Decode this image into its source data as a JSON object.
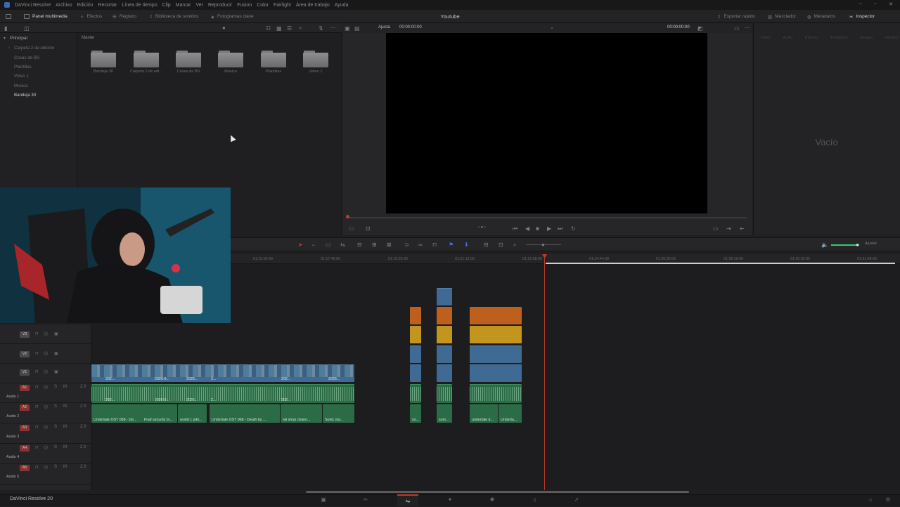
{
  "menu": {
    "items": [
      "DaVinci Resolve",
      "Archivo",
      "Edición",
      "Recortar",
      "Línea de tiempo",
      "Clip",
      "Marcar",
      "Ver",
      "Reproducir",
      "Fusion",
      "Color",
      "Fairlight",
      "Área de trabajo",
      "Ayuda"
    ]
  },
  "toolbar": {
    "media_pool": "Panel multimedia",
    "effects": "Efectos",
    "log": "Registro",
    "sound_library": "Biblioteca de sonidos",
    "keyframes": "Fotogramas clave",
    "project_title": "Youtube",
    "quick_export": "Exportar rápido",
    "mixer": "Mezclador",
    "metadata": "Metadatos",
    "inspector": "Inspector"
  },
  "viewer": {
    "zoom": "Ajusta",
    "timecode_left": "00:00:00:00",
    "timecode_right": "00:00:00:00"
  },
  "media_pool": {
    "root": "Principal",
    "bins": [
      "Carpeta 2 de edición",
      "Cosas de BS",
      "Plantillas",
      "Video 1",
      "Musica",
      "Bandeja 30"
    ],
    "breadcrumb": "Master",
    "folders": [
      "Bandeja 30",
      "Carpeta 2 de edi...",
      "Cosas de BS",
      "Musica",
      "Plantillas",
      "Video 1"
    ]
  },
  "inspector": {
    "empty": "Vacío",
    "tabs": [
      "Video",
      "Audio",
      "Efectos",
      "Transición",
      "Imagen",
      "Archivo"
    ]
  },
  "timeline": {
    "ruler": [
      "01:15:54:00",
      "01:17:40:00",
      "01:19:26:00",
      "01:21:12:00",
      "01:22:58:00",
      "01:24:44:00",
      "01:26:30:00",
      "01:28:16:00",
      "01:30:02:00",
      "01:31:48:00"
    ],
    "tracks": [
      {
        "id": "V3",
        "name": ""
      },
      {
        "id": "V2",
        "name": ""
      },
      {
        "id": "V1",
        "name": ""
      },
      {
        "id": "A1",
        "name": "Audio 1",
        "level": "2.0"
      },
      {
        "id": "A2",
        "name": "Audio 2",
        "level": "2.0"
      },
      {
        "id": "A3",
        "name": "Audio 3",
        "level": "2.0"
      },
      {
        "id": "A4",
        "name": "Audio 4",
        "level": "2.0"
      },
      {
        "id": "A5",
        "name": "Audio 5",
        "level": "2.0"
      }
    ],
    "clip_labels": {
      "v1": [
        "202...",
        "2026-0...",
        "2026...",
        "2...",
        "202...",
        "2026..."
      ],
      "a1": [
        "202...",
        "2026-0...",
        "2026...",
        "2...",
        "202..."
      ],
      "a2": [
        "Undertale OST 068 - De...",
        "Fnaf security br...",
        "world 1 pibi...",
        "Undertale OST 068 - Death by ...",
        "wii shop chann...",
        "Sonic ma..."
      ],
      "mid": [
        "so...",
        "soni...",
        "undertale d...",
        "Underta..."
      ]
    },
    "mute_label": "Ajustar"
  },
  "bottom": {
    "brand": "DaVinci Resolve 20"
  },
  "colors": {
    "accent_red": "#c0392b",
    "video_clip": "#3e6a93",
    "audio_clip": "#2b6b46",
    "orange": "#bf5f1e",
    "yellow": "#c2951e"
  }
}
